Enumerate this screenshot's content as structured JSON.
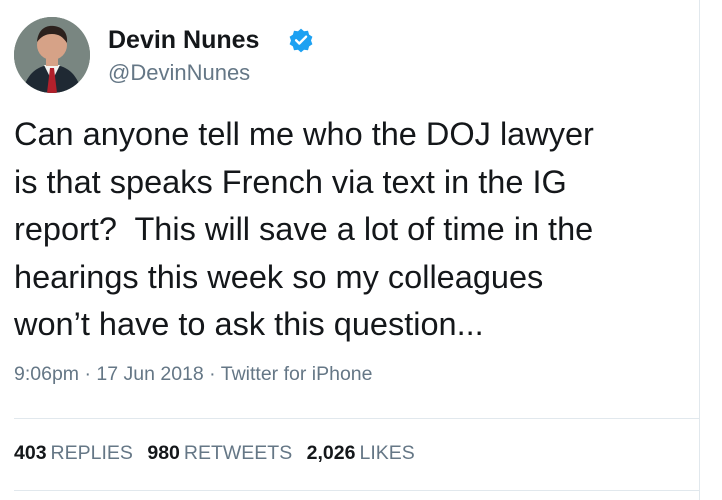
{
  "author": {
    "name": "Devin Nunes",
    "handle": "@DevinNunes",
    "verified_icon": "verified-badge",
    "verified_color": "#1da1f2"
  },
  "tweet": {
    "text": "Can anyone tell me who the DOJ lawyer\nis that speaks French via text in the IG\nreport?  This will save a lot of time in the\nhearings this week so my colleagues\nwon’t have to ask this question..."
  },
  "meta": {
    "time": "9:06pm",
    "separator_1": "·",
    "date": "17 Jun 2018",
    "separator_2": "·",
    "source": "Twitter for iPhone"
  },
  "stats": {
    "replies": {
      "value": "403",
      "label": "REPLIES"
    },
    "retweets": {
      "value": "980",
      "label": "RETWEETS"
    },
    "likes": {
      "value": "2,026",
      "label": "LIKES"
    }
  },
  "colors": {
    "text": "#14171a",
    "secondary": "#657786",
    "divider": "#e1e8ed"
  }
}
